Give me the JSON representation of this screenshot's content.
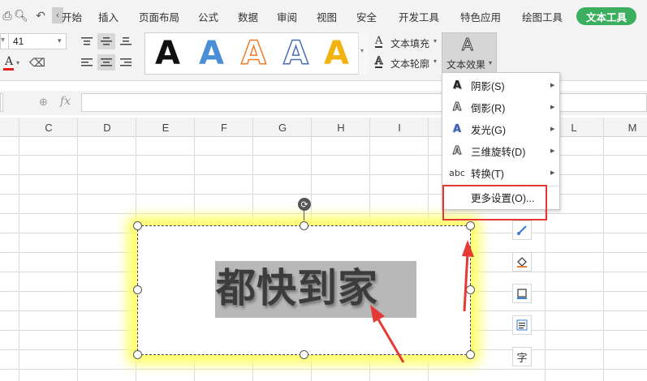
{
  "menubar": {
    "tabs": [
      "开始",
      "插入",
      "页面布局",
      "公式",
      "数据",
      "审阅",
      "视图",
      "安全",
      "开发工具",
      "特色应用",
      "绘图工具"
    ],
    "active_tab": "文本工具"
  },
  "ribbon": {
    "font_size": "41",
    "text_fill_label": "文本填充",
    "text_outline_label": "文本轮廓",
    "text_effect_label": "文本效果"
  },
  "gallery": {
    "letter": "A"
  },
  "formula_bar": {
    "fx_label": "fx"
  },
  "columns": [
    "C",
    "D",
    "E",
    "F",
    "G",
    "H",
    "I",
    "L",
    "M"
  ],
  "dropdown": {
    "items": [
      {
        "icon": "A",
        "label": "阴影(S)",
        "arrow": "▶"
      },
      {
        "icon": "A",
        "label": "倒影(R)",
        "arrow": "▶"
      },
      {
        "icon": "A",
        "label": "发光(G)",
        "arrow": "▶"
      },
      {
        "icon": "A",
        "label": "三维旋转(D)",
        "arrow": "▶"
      },
      {
        "icon": "abc",
        "label": "转换(T)",
        "arrow": "▶"
      }
    ],
    "more_settings": "更多设置(O)..."
  },
  "textbox": {
    "wordart_text": "都快到家"
  },
  "side_toolbar": {
    "text_button_label": "字"
  },
  "colors": {
    "accent_green": "#3cae5f",
    "annotation_red": "#e53935",
    "glow_yellow": "#ffff66"
  }
}
